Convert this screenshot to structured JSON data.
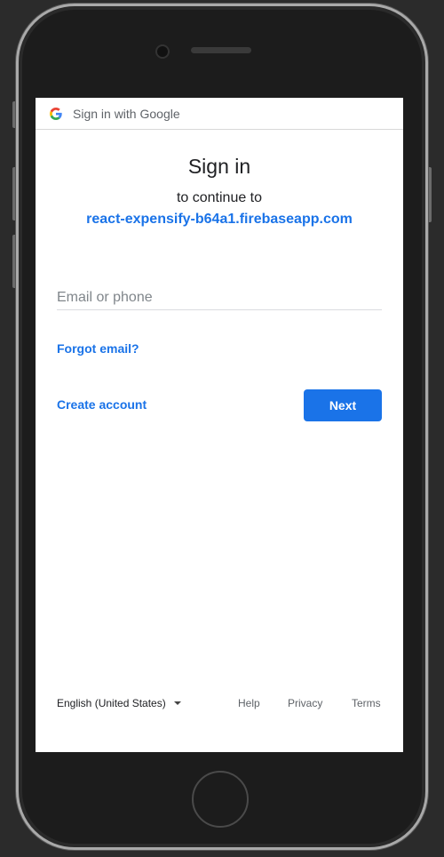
{
  "header": {
    "logo_icon": "google-g-icon",
    "label": "Sign in with Google"
  },
  "main": {
    "title": "Sign in",
    "subtitle": "to continue to",
    "site": "react-expensify-b64a1.firebaseapp.com",
    "email_placeholder": "Email or phone",
    "email_value": "",
    "forgot_label": "Forgot email?",
    "create_label": "Create account",
    "next_label": "Next"
  },
  "footer": {
    "language": "English (United States)",
    "help": "Help",
    "privacy": "Privacy",
    "terms": "Terms"
  },
  "colors": {
    "accent": "#1a73e8",
    "text": "#202124",
    "muted": "#5f6368",
    "device_frame": "#1c1c1c",
    "background": "#2b2b2b"
  }
}
